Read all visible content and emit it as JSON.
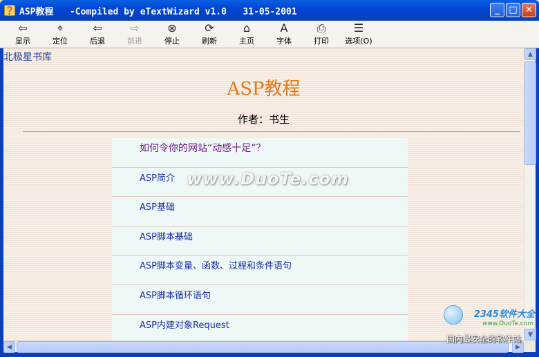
{
  "window": {
    "title": "ASP教程   -Compiled by eTextWizard v1.0   31-05-2001",
    "minimize": "_",
    "maximize": "□",
    "close": "✕"
  },
  "toolbar": {
    "items": [
      {
        "label": "显示",
        "icon": "show-icon",
        "glyph": "⇦"
      },
      {
        "label": "定位",
        "icon": "locate-icon",
        "glyph": "⌖"
      },
      {
        "label": "后退",
        "icon": "back-icon",
        "glyph": "⇦"
      },
      {
        "label": "前进",
        "icon": "forward-icon",
        "glyph": "⇨",
        "disabled": true
      },
      {
        "label": "停止",
        "icon": "stop-icon",
        "glyph": "⊗"
      },
      {
        "label": "刷新",
        "icon": "refresh-icon",
        "glyph": "⟳"
      },
      {
        "label": "主页",
        "icon": "home-icon",
        "glyph": "⌂"
      },
      {
        "label": "字体",
        "icon": "font-icon",
        "glyph": "A"
      },
      {
        "label": "打印",
        "icon": "print-icon",
        "glyph": "⎙"
      },
      {
        "label": "选项(O)",
        "icon": "options-icon",
        "glyph": "☰"
      }
    ]
  },
  "content": {
    "site_name": "北极星书库",
    "title": "ASP教程",
    "author": "作者：书生",
    "watermark": "www.DuoTe.com",
    "toc": [
      "如何令你的网站“动感十足”？",
      "ASP简介",
      "ASP基础",
      "ASP脚本基础",
      "ASP脚本变量、函数、过程和条件语句",
      "ASP脚本循环语句",
      "ASP内建对象Request"
    ]
  },
  "logo": {
    "brand": "2345软件大全",
    "url": "www.DuoTe.com",
    "slogan": "国内最安全的软件站"
  },
  "colors": {
    "title_bar": "#0046d5",
    "heading": "#e07a1a",
    "link": "#1a2fa8"
  }
}
